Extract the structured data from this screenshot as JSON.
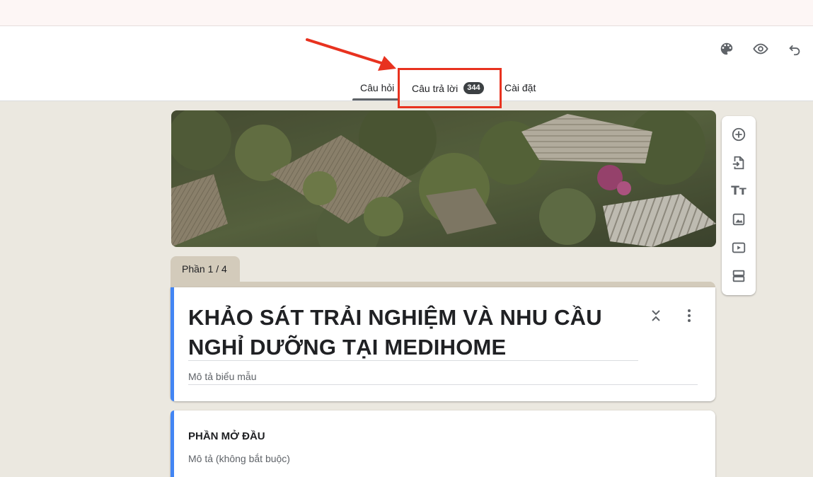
{
  "header": {
    "icons": [
      "palette-icon",
      "eye-icon",
      "undo-icon"
    ]
  },
  "tabs": {
    "questions": "Câu hỏi",
    "responses": "Câu trả lời",
    "responses_count": "344",
    "settings": "Cài đặt"
  },
  "section_tab": "Phần 1 / 4",
  "form": {
    "title": "KHẢO SÁT TRẢI NGHIỆM VÀ NHU CẦU NGHỈ DƯỠNG TẠI MEDIHOME",
    "description_placeholder": "Mô tả biểu mẫu"
  },
  "section": {
    "title": "PHẦN MỞ ĐẦU",
    "description_placeholder": "Mô tả (không bắt buộc)"
  },
  "toolbar": {
    "items": [
      "add-question-icon",
      "import-questions-icon",
      "add-title-icon",
      "add-image-icon",
      "add-video-icon",
      "add-section-icon"
    ],
    "title_glyph": "Tт"
  },
  "colors": {
    "accent": "#4285f4",
    "highlight": "#e8321f",
    "background": "#ebe8e0",
    "section_tab": "#d3cbbb"
  }
}
